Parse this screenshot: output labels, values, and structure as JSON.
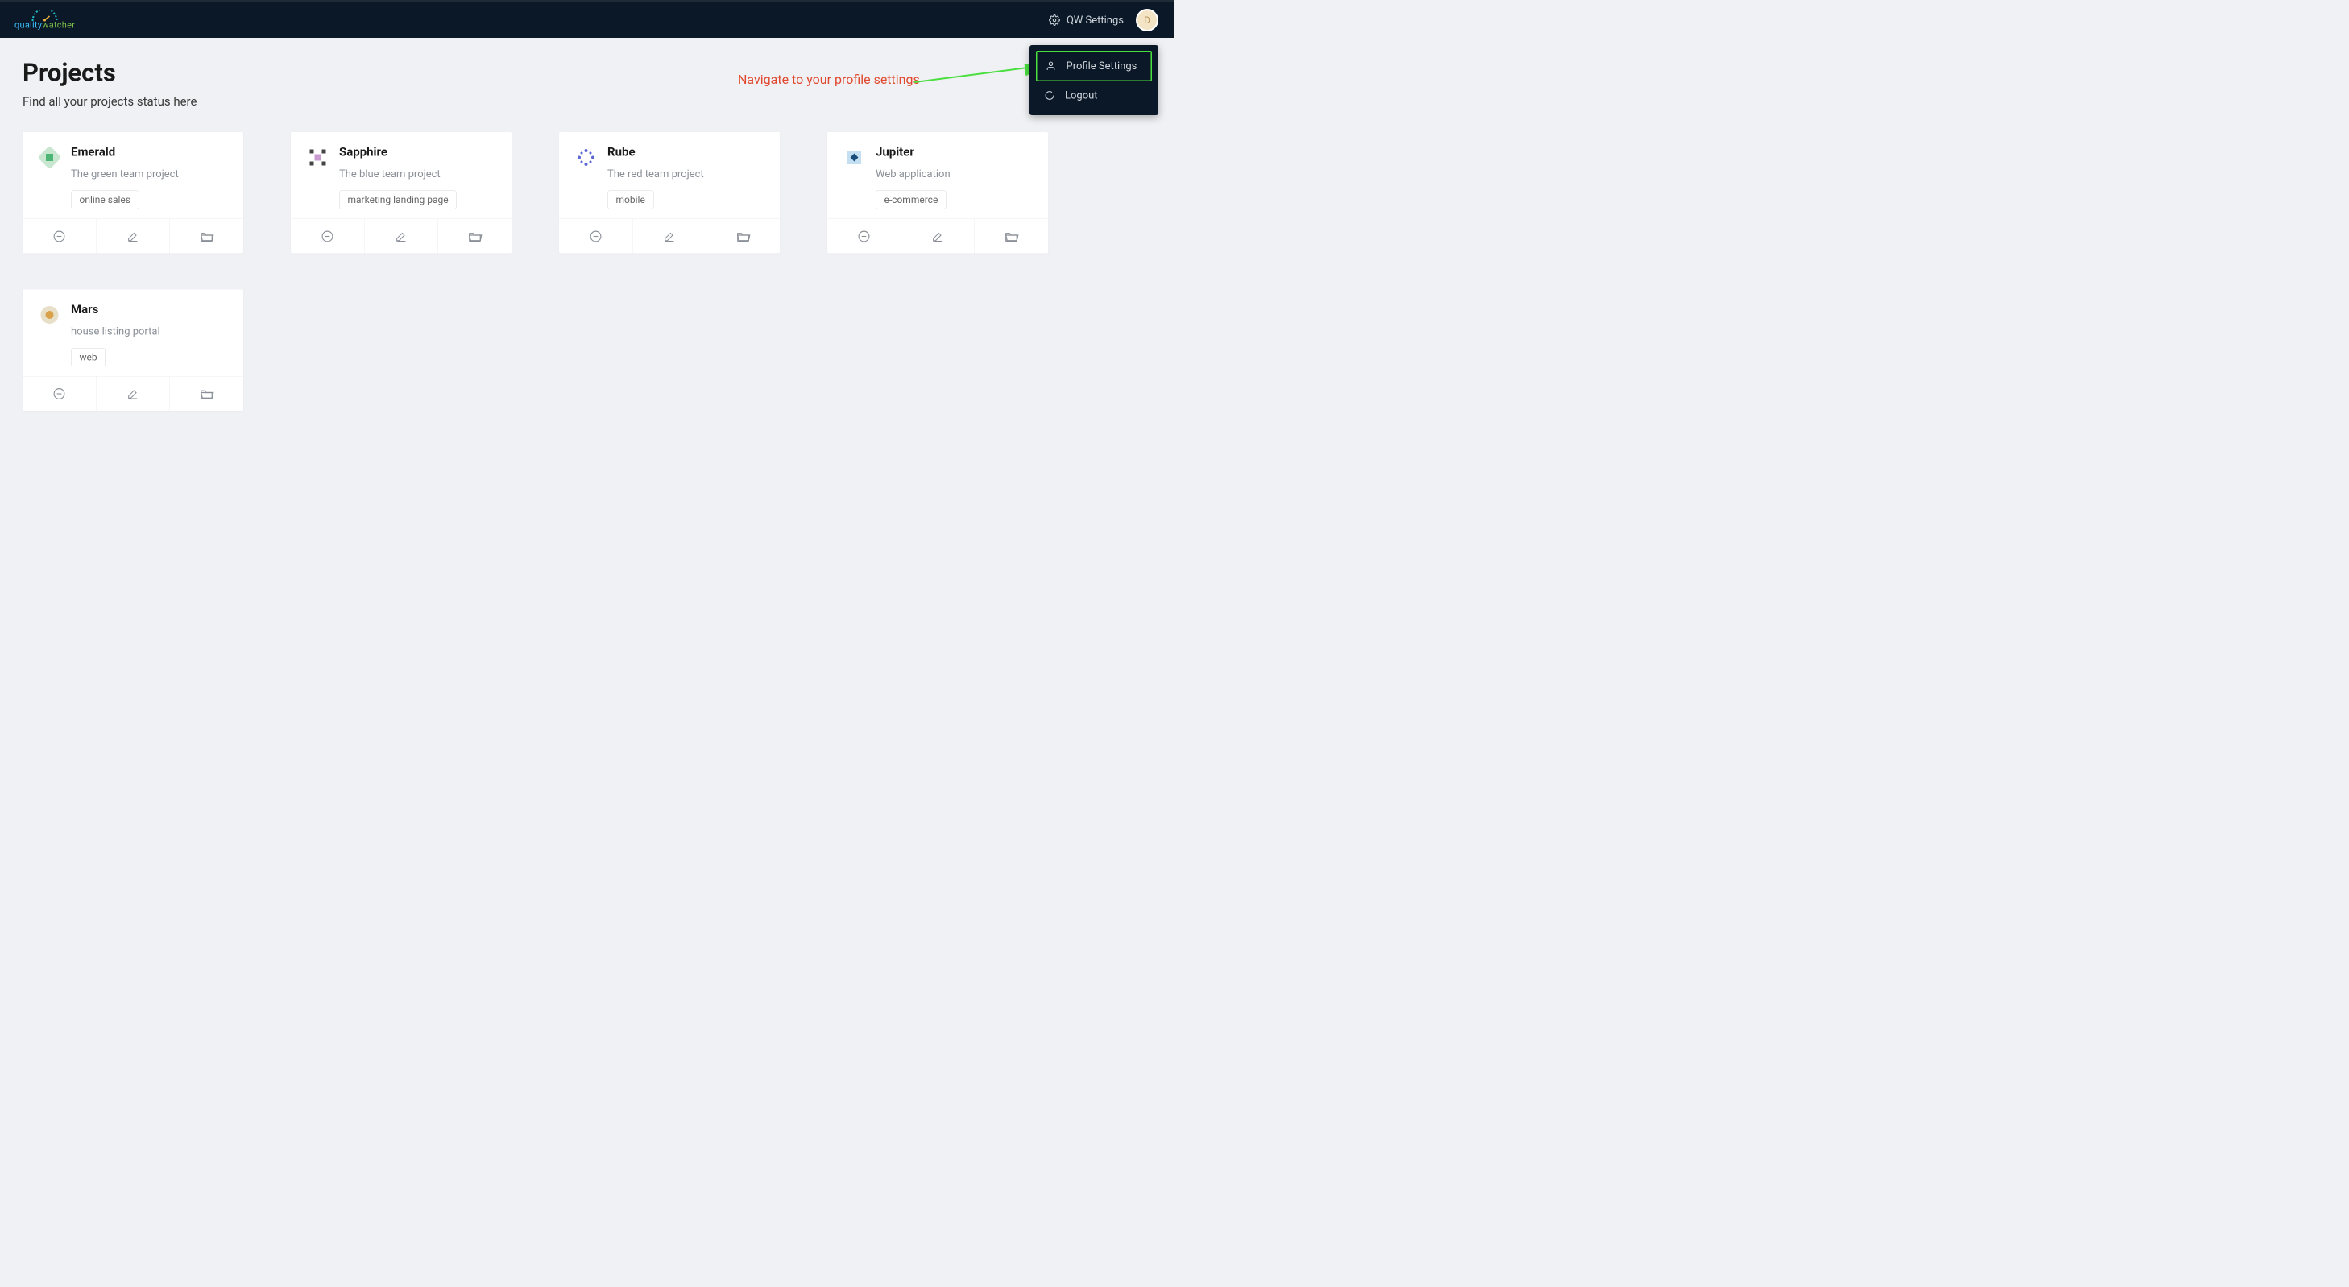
{
  "header": {
    "logo_text1": "quality",
    "logo_text2": "watcher",
    "settings_label": "QW Settings",
    "avatar_letter": "D"
  },
  "dropdown": {
    "profile": "Profile Settings",
    "logout": "Logout"
  },
  "page": {
    "title": "Projects",
    "subtitle": "Find all your projects status here"
  },
  "annotation": {
    "text": "Navigate to your profile settings"
  },
  "projects": [
    {
      "name": "Emerald",
      "desc": "The green team project",
      "tag": "online sales"
    },
    {
      "name": "Sapphire",
      "desc": "The blue team project",
      "tag": "marketing landing page"
    },
    {
      "name": "Rube",
      "desc": "The red team project",
      "tag": "mobile"
    },
    {
      "name": "Jupiter",
      "desc": "Web application",
      "tag": "e-commerce"
    },
    {
      "name": "Mars",
      "desc": "house listing portal",
      "tag": "web"
    }
  ]
}
